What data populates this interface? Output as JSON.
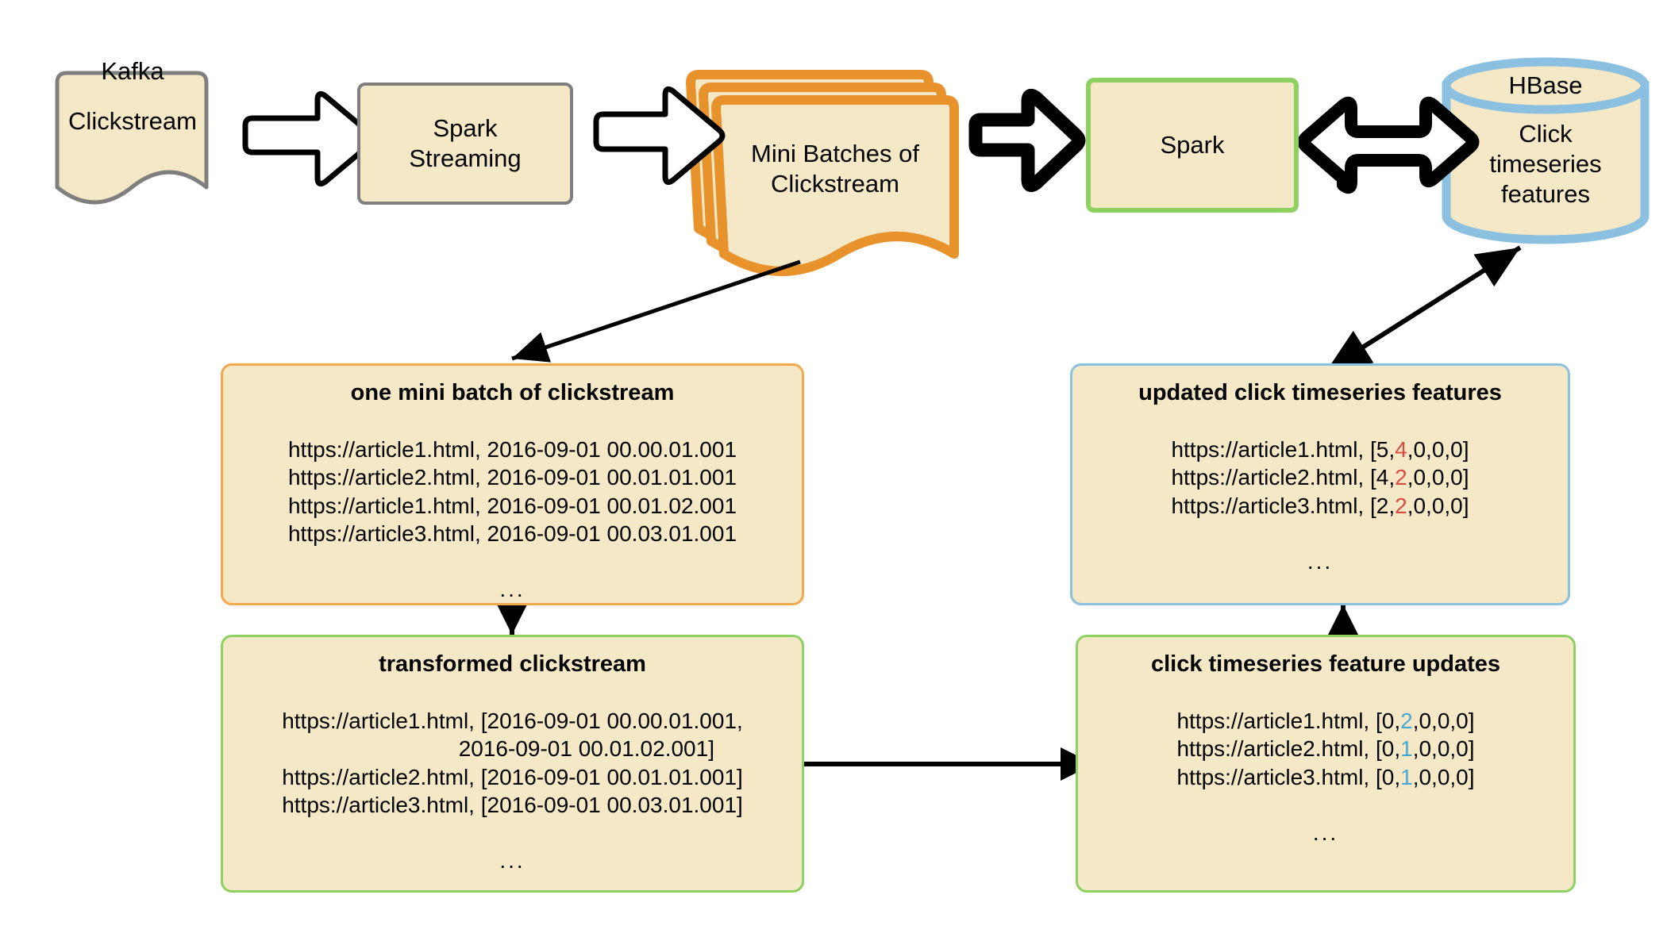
{
  "diagram": {
    "title": "Spark Streaming clickstream pipeline",
    "colors": {
      "fill": "#F5E8C6",
      "gray_border": "#7F7F7F",
      "orange_border": "#E8922B",
      "green_border": "#8FD160",
      "blue_border": "#8BC0E0",
      "panel_orange": "#F0A94C",
      "highlight_red": "#D94B43",
      "highlight_blue": "#49A7D4",
      "arrow": "#000000"
    }
  },
  "pipeline": {
    "kafka": {
      "tag": "Kafka",
      "label": "Clickstream",
      "shape": "document"
    },
    "spark_streaming": {
      "label": "Spark\nStreaming",
      "shape": "process"
    },
    "mini_batches": {
      "label": "Mini Batches of\nClickstream",
      "shape": "stacked-document"
    },
    "spark": {
      "label": "Spark",
      "shape": "process"
    },
    "hbase": {
      "tag": "HBase",
      "label": "Click\ntimeseries\nfeatures",
      "shape": "cylinder"
    }
  },
  "arrows": {
    "kafka_to_streaming": "block-arrow-right",
    "streaming_to_batches": "block-arrow-right",
    "batches_to_spark": "block-arrow-right-bold",
    "spark_to_hbase": "block-arrow-bidirectional",
    "batches_to_detail": "line-arrow-down-left",
    "hbase_to_detail": "line-arrow-bidirectional-diagonal",
    "minibatch_to_transformed": "line-arrow-down",
    "transformed_to_updates": "line-arrow-right",
    "updates_to_features": "line-arrow-up"
  },
  "panels": {
    "mini_batch": {
      "title": "one mini batch of clickstream",
      "rows": [
        "https://article1.html, 2016-09-01 00.00.01.001",
        "https://article2.html, 2016-09-01 00.01.01.001",
        "https://article1.html, 2016-09-01 00.01.02.001",
        "https://article3.html, 2016-09-01 00.03.01.001"
      ],
      "ellipsis": "..."
    },
    "transformed": {
      "title": "transformed clickstream",
      "rows": [
        "https://article1.html, [2016-09-01 00.00.01.001,",
        "                        2016-09-01 00.01.02.001]",
        "https://article2.html, [2016-09-01 00.01.01.001]",
        "https://article3.html, [2016-09-01 00.03.01.001]"
      ],
      "ellipsis": "..."
    },
    "updated_features": {
      "title": "updated click timeseries features",
      "rows": [
        {
          "prefix": "https://article1.html, [5,",
          "highlight": "4",
          "suffix": ",0,0,0]"
        },
        {
          "prefix": "https://article2.html, [4,",
          "highlight": "2",
          "suffix": ",0,0,0]"
        },
        {
          "prefix": "https://article3.html, [2,",
          "highlight": "2",
          "suffix": ",0,0,0]"
        }
      ],
      "ellipsis": "..."
    },
    "feature_updates": {
      "title": "click timeseries feature updates",
      "rows": [
        {
          "prefix": "https://article1.html, [0,",
          "highlight": "2",
          "suffix": ",0,0,0]"
        },
        {
          "prefix": "https://article2.html, [0,",
          "highlight": "1",
          "suffix": ",0,0,0]"
        },
        {
          "prefix": "https://article3.html, [0,",
          "highlight": "1",
          "suffix": ",0,0,0]"
        }
      ],
      "ellipsis": "..."
    }
  }
}
